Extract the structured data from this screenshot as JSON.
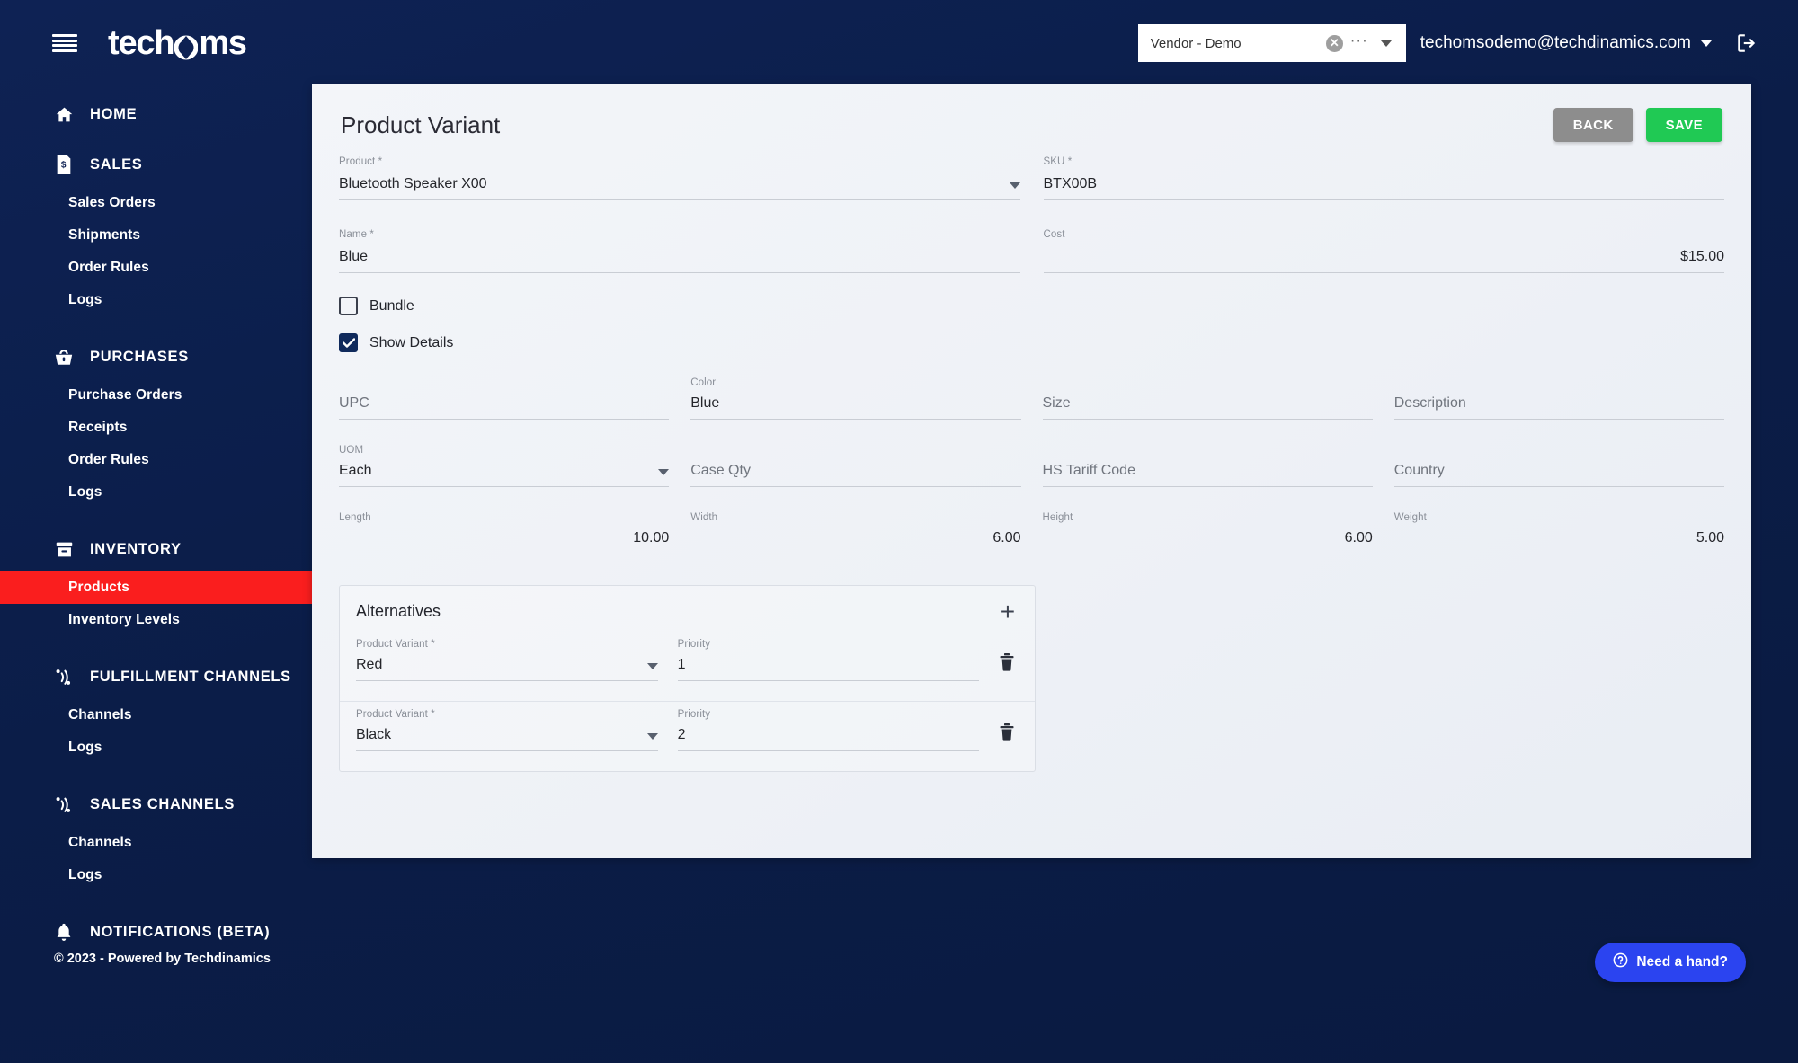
{
  "brand": {
    "name": "techoms"
  },
  "topbar": {
    "vendor": {
      "value": "Vendor - Demo",
      "clear_icon": "clear-circle-icon",
      "more_icon": "ellipsis-icon",
      "caret_icon": "chevron-down-icon"
    },
    "user_email": "techomsodemo@techdinamics.com",
    "logout_icon": "logout-icon"
  },
  "sidebar": {
    "groups": [
      {
        "label": "HOME",
        "icon": "home-icon",
        "items": []
      },
      {
        "label": "SALES",
        "icon": "sales-document-icon",
        "items": [
          {
            "label": "Sales Orders",
            "active": false
          },
          {
            "label": "Shipments",
            "active": false
          },
          {
            "label": "Order Rules",
            "active": false
          },
          {
            "label": "Logs",
            "active": false
          }
        ]
      },
      {
        "label": "PURCHASES",
        "icon": "basket-icon",
        "items": [
          {
            "label": "Purchase Orders",
            "active": false
          },
          {
            "label": "Receipts",
            "active": false
          },
          {
            "label": "Order Rules",
            "active": false
          },
          {
            "label": "Logs",
            "active": false
          }
        ]
      },
      {
        "label": "INVENTORY",
        "icon": "inventory-box-icon",
        "items": [
          {
            "label": "Products",
            "active": true
          },
          {
            "label": "Inventory Levels",
            "active": false
          }
        ]
      },
      {
        "label": "FULFILLMENT CHANNELS",
        "icon": "channels-icon",
        "items": [
          {
            "label": "Channels",
            "active": false
          },
          {
            "label": "Logs",
            "active": false
          }
        ]
      },
      {
        "label": "SALES CHANNELS",
        "icon": "channels-icon",
        "items": [
          {
            "label": "Channels",
            "active": false
          },
          {
            "label": "Logs",
            "active": false
          }
        ]
      },
      {
        "label": "NOTIFICATIONS (BETA)",
        "icon": "bell-icon",
        "items": []
      }
    ]
  },
  "page": {
    "title": "Product Variant",
    "back_label": "BACK",
    "save_label": "SAVE"
  },
  "form": {
    "product": {
      "label": "Product *",
      "value": "Bluetooth Speaker X00",
      "type": "select"
    },
    "sku": {
      "label": "SKU *",
      "value": "BTX00B"
    },
    "name": {
      "label": "Name *",
      "value": "Blue"
    },
    "cost": {
      "label": "Cost",
      "value": "$15.00"
    },
    "bundle": {
      "label": "Bundle",
      "checked": false
    },
    "show_details": {
      "label": "Show Details",
      "checked": true
    },
    "upc": {
      "label": "UPC",
      "value": ""
    },
    "color": {
      "label": "Color",
      "value": "Blue"
    },
    "size": {
      "label": "Size",
      "value": ""
    },
    "description": {
      "label": "Description",
      "value": ""
    },
    "uom": {
      "label": "UOM",
      "value": "Each",
      "type": "select"
    },
    "case_qty": {
      "label": "Case Qty",
      "value": ""
    },
    "hs_tariff_code": {
      "label": "HS Tariff Code",
      "value": ""
    },
    "country": {
      "label": "Country",
      "value": ""
    },
    "length": {
      "label": "Length",
      "value": "10.00"
    },
    "width": {
      "label": "Width",
      "value": "6.00"
    },
    "height": {
      "label": "Height",
      "value": "6.00"
    },
    "weight": {
      "label": "Weight",
      "value": "5.00"
    }
  },
  "alternatives": {
    "title": "Alternatives",
    "add_icon": "plus-icon",
    "variant_label": "Product Variant *",
    "priority_label": "Priority",
    "delete_icon": "trash-icon",
    "rows": [
      {
        "variant": "Red",
        "priority": "1"
      },
      {
        "variant": "Black",
        "priority": "2"
      }
    ]
  },
  "footer": {
    "text": "© 2023 - Powered by Techdinamics"
  },
  "help": {
    "label": "Need a hand?",
    "icon": "question-circle-icon"
  },
  "colors": {
    "sidebar_bg": "#0e2254",
    "active_item": "#fa1e1e",
    "save_green": "#20c954",
    "back_gray": "#8d8d8d",
    "help_blue": "#2b44f0"
  }
}
